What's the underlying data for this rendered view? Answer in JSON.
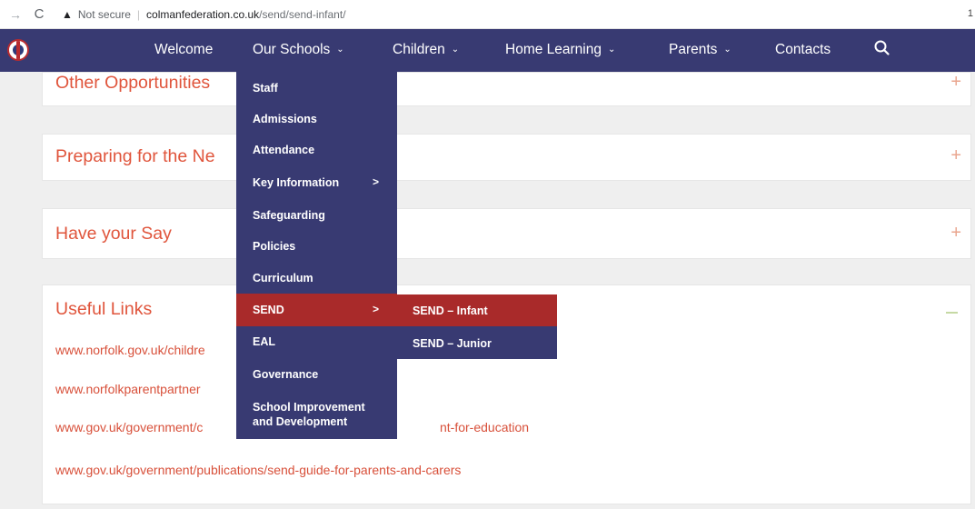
{
  "browser": {
    "back_icon": "arrow-right",
    "reload_icon": "reload",
    "security_label": "Not secure",
    "url_host": "colmanfederation.co.uk",
    "url_path": "/send/send-infant/",
    "corner_text": "1"
  },
  "nav": {
    "items": [
      {
        "label": "Welcome"
      },
      {
        "label": "Our Schools"
      },
      {
        "label": "Children"
      },
      {
        "label": "Home Learning"
      },
      {
        "label": "Parents"
      },
      {
        "label": "Contacts"
      }
    ],
    "chevron": "⌄"
  },
  "panels": {
    "other": {
      "title": "Other Opportunities",
      "toggle": "+"
    },
    "preparing": {
      "title": "Preparing for the Ne",
      "toggle": "+"
    },
    "say": {
      "title": "Have your Say",
      "toggle": "+"
    },
    "useful": {
      "title": "Useful Links",
      "links": [
        "www.norfolk.gov.uk/childre",
        "www.norfolkparentpartner",
        "www.gov.uk/government/c",
        "www.gov.uk/government/publications/send-guide-for-parents-and-carers"
      ],
      "link_tail": "nt-for-education"
    }
  },
  "dropdown": {
    "items": [
      {
        "label": "Staff"
      },
      {
        "label": "Admissions"
      },
      {
        "label": "Attendance"
      },
      {
        "label": "Key Information",
        "arrow": ">"
      },
      {
        "label": "Safeguarding"
      },
      {
        "label": "Policies"
      },
      {
        "label": "Curriculum"
      },
      {
        "label": "SEND",
        "arrow": ">"
      },
      {
        "label": "EAL"
      },
      {
        "label": "Governance"
      },
      {
        "line1": "School Improvement",
        "line2": "and Development"
      }
    ]
  },
  "submenu": {
    "items": [
      {
        "label": "SEND – Infant"
      },
      {
        "label": "SEND – Junior"
      }
    ]
  },
  "colors": {
    "nav_bg": "#383a72",
    "active_bg": "#a92a2a",
    "heading": "#e0553c",
    "page_bg": "#efefef"
  }
}
